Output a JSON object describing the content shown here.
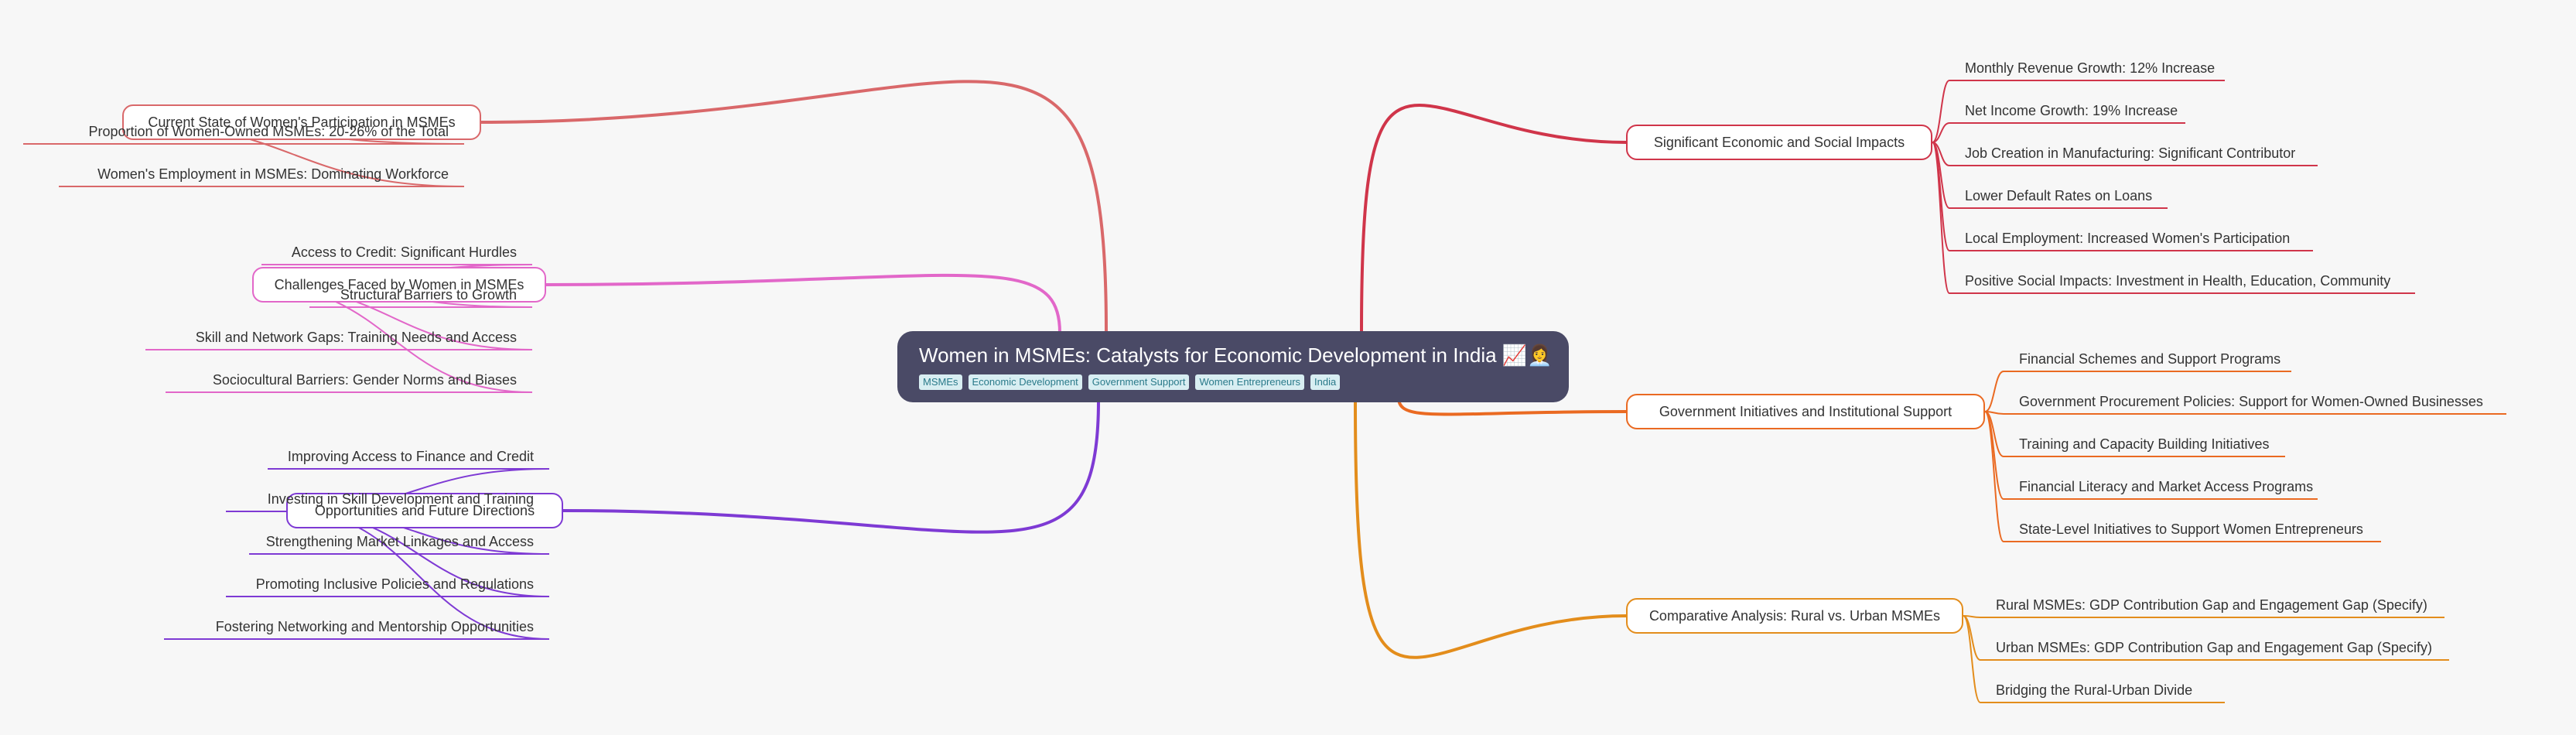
{
  "root": {
    "title": "Women in MSMEs: Catalysts for Economic Development in India 📈👩‍💼",
    "tags": [
      "MSMEs",
      "Economic Development",
      "Government Support",
      "Women Entrepreneurs",
      "India"
    ]
  },
  "branches": [
    {
      "label": "Significant Economic and Social Impacts",
      "color": "#d0354a",
      "children": [
        "Monthly Revenue Growth: 12% Increase",
        "Net Income Growth: 19% Increase",
        "Job Creation in Manufacturing: Significant Contributor",
        "Lower Default Rates on Loans",
        "Local Employment: Increased Women's Participation",
        "Positive Social Impacts: Investment in Health, Education, Community"
      ]
    },
    {
      "label": "Government Initiatives and Institutional Support",
      "color": "#ea6a22",
      "children": [
        "Financial Schemes and Support Programs",
        "Government Procurement Policies: Support for Women-Owned Businesses",
        "Training and Capacity Building Initiatives",
        "Financial Literacy and Market Access Programs",
        "State-Level Initiatives to Support Women Entrepreneurs"
      ]
    },
    {
      "label": "Comparative Analysis: Rural vs. Urban MSMEs",
      "color": "#e38d1c",
      "children": [
        "Rural MSMEs: GDP Contribution Gap and Engagement Gap (Specify)",
        "Urban MSMEs: GDP Contribution Gap and Engagement Gap (Specify)",
        "Bridging the Rural-Urban Divide"
      ]
    },
    {
      "label": "Current State of Women's Participation in MSMEs",
      "color": "#d9686a",
      "children": [
        "Proportion of Women-Owned MSMEs: 20-26% of the Total",
        "Women's Employment in MSMEs: Dominating Workforce"
      ]
    },
    {
      "label": "Challenges Faced by Women in MSMEs",
      "color": "#e267c9",
      "children": [
        "Access to Credit: Significant Hurdles",
        "Structural Barriers to Growth",
        "Skill and Network Gaps: Training Needs and Access",
        "Sociocultural Barriers: Gender Norms and Biases"
      ]
    },
    {
      "label": "Opportunities and Future Directions",
      "color": "#7e3ad4",
      "children": [
        "Improving Access to Finance and Credit",
        "Investing in Skill Development and Training",
        "Strengthening Market Linkages and Access",
        "Promoting Inclusive Policies and Regulations",
        "Fostering Networking and Mentorship Opportunities"
      ]
    }
  ]
}
